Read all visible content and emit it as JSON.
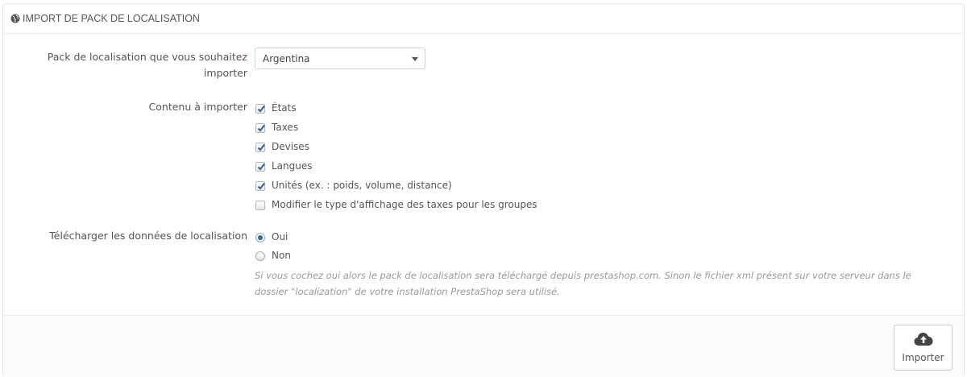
{
  "panel": {
    "title": "IMPORT DE PACK DE LOCALISATION",
    "title_icon": "globe-icon"
  },
  "pack": {
    "label": "Pack de localisation que vous souhaitez importer",
    "label_line1": "Pack de localisation que vous souhaitez",
    "label_line2": "importer",
    "selected": "Argentina"
  },
  "content": {
    "label": "Contenu à importer",
    "options": [
      {
        "label": "États",
        "checked": true
      },
      {
        "label": "Taxes",
        "checked": true
      },
      {
        "label": "Devises",
        "checked": true
      },
      {
        "label": "Langues",
        "checked": true
      },
      {
        "label": "Unités (ex. : poids, volume, distance)",
        "checked": true
      },
      {
        "label": "Modifier le type d'affichage des taxes pour les groupes",
        "checked": false
      }
    ]
  },
  "download": {
    "label": "Télécharger les données de localisation",
    "options": [
      {
        "label": "Oui",
        "selected": true
      },
      {
        "label": "Non",
        "selected": false
      }
    ],
    "help_line1": "Si vous cochez oui alors le pack de localisation sera téléchargé depuis prestashop.com. Sinon le fichier xml présent sur votre serveur dans le",
    "help_line2": "dossier \"localization\" de votre installation PrestaShop sera utilisé."
  },
  "footer": {
    "submit_label": "Importer",
    "submit_icon": "cloud-upload-icon"
  },
  "colors": {
    "accent": "#2d6ea8",
    "footer_bg": "#fafbfc",
    "help_text": "#999999"
  }
}
